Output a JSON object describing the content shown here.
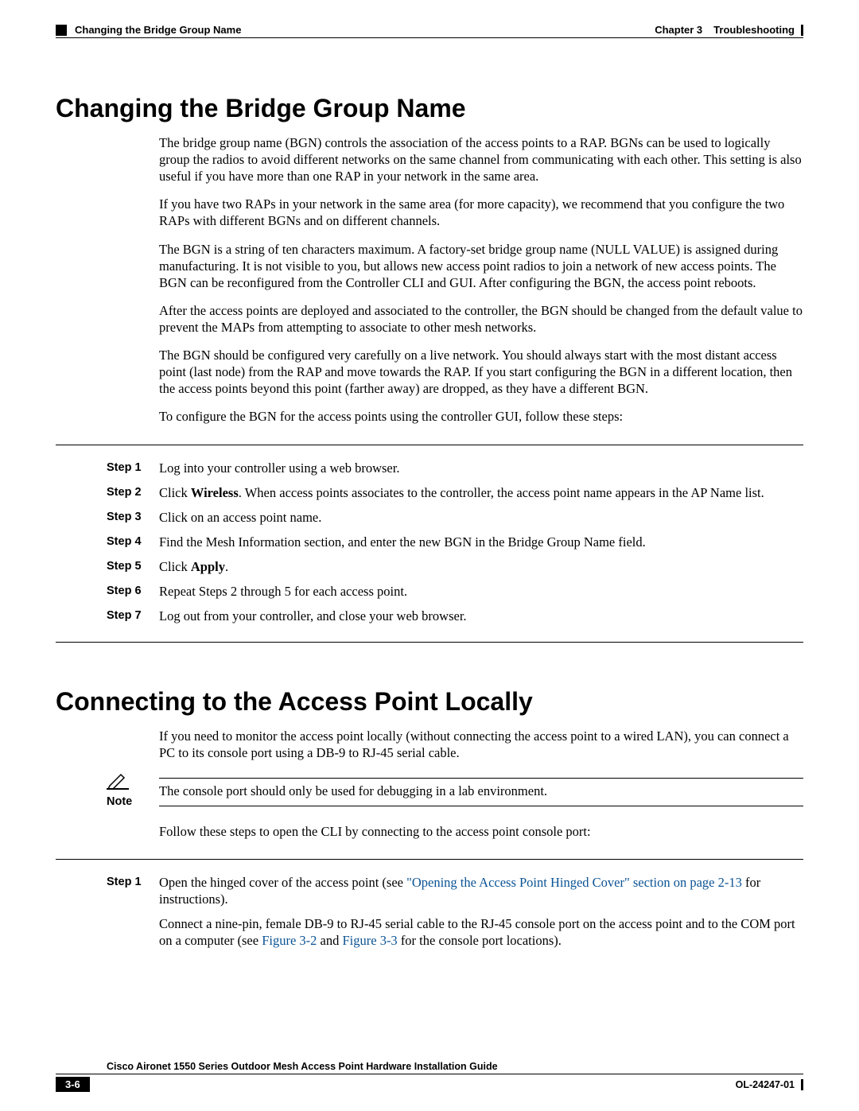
{
  "header": {
    "running_head_left": "Changing the Bridge Group Name",
    "chapter_label": "Chapter 3",
    "chapter_title": "Troubleshooting"
  },
  "section1": {
    "title": "Changing the Bridge Group Name",
    "p1": "The bridge group name (BGN) controls the association of the access points to a RAP. BGNs can be used to logically group the radios to avoid different networks on the same channel from communicating with each other. This setting is also useful if you have more than one RAP in your network in the same area.",
    "p2": "If you have two RAPs in your network in the same area (for more capacity), we recommend that you configure the two RAPs with different BGNs and on different channels.",
    "p3": "The BGN is a string of ten characters maximum. A factory-set bridge group name (NULL VALUE) is assigned during manufacturing. It is not visible to you, but allows new access point radios to join a network of new access points. The BGN can be reconfigured from the Controller CLI and GUI. After configuring the BGN, the access point reboots.",
    "p4": "After the access points are deployed and associated to the controller, the BGN should be changed from the default value to prevent the MAPs from attempting to associate to other mesh networks.",
    "p5": "The BGN should be configured very carefully on a live network. You should always start with the most distant access point (last node) from the RAP and move towards the RAP. If you start configuring the BGN in a different location, then the access points beyond this point (farther away) are dropped, as they have a different BGN.",
    "p6": "To configure the BGN for the access points using the controller GUI, follow these steps:",
    "steps": [
      {
        "label": "Step 1",
        "text_pre": "Log into your controller using a web browser.",
        "bold": "",
        "text_post": ""
      },
      {
        "label": "Step 2",
        "text_pre": "Click ",
        "bold": "Wireless",
        "text_post": ". When access points associates to the controller, the access point name appears in the AP Name list."
      },
      {
        "label": "Step 3",
        "text_pre": "Click on an access point name.",
        "bold": "",
        "text_post": ""
      },
      {
        "label": "Step 4",
        "text_pre": "Find the Mesh Information section, and enter the new BGN in the Bridge Group Name field.",
        "bold": "",
        "text_post": ""
      },
      {
        "label": "Step 5",
        "text_pre": "Click ",
        "bold": "Apply",
        "text_post": "."
      },
      {
        "label": "Step 6",
        "text_pre": "Repeat Steps 2 through 5 for each access point.",
        "bold": "",
        "text_post": ""
      },
      {
        "label": "Step 7",
        "text_pre": "Log out from your controller, and close your web browser.",
        "bold": "",
        "text_post": ""
      }
    ]
  },
  "section2": {
    "title": "Connecting to the Access Point Locally",
    "p1": "If you need to monitor the access point locally (without connecting the access point to a wired LAN), you can connect a PC to its console port using a DB-9 to RJ-45 serial cable.",
    "note_label": "Note",
    "note_text": "The console port should only be used for debugging in a lab environment.",
    "p2": "Follow these steps to open the CLI by connecting to the access point console port:",
    "step1": {
      "label": "Step 1",
      "pre": "Open the hinged cover of the access point (see ",
      "link1": "\"Opening the Access Point Hinged Cover\" section on page 2-13",
      "post": " for instructions)."
    },
    "p3_pre": "Connect a nine-pin, female DB-9 to RJ-45 serial cable to the RJ-45 console port on the access point and to the COM port on a computer (see ",
    "p3_link1": "Figure 3-2",
    "p3_mid": " and ",
    "p3_link2": "Figure 3-3",
    "p3_post": " for the console port locations)."
  },
  "footer": {
    "guide_title": "Cisco Aironet 1550 Series Outdoor Mesh Access Point Hardware Installation Guide",
    "page_number": "3-6",
    "doc_id": "OL-24247-01"
  }
}
